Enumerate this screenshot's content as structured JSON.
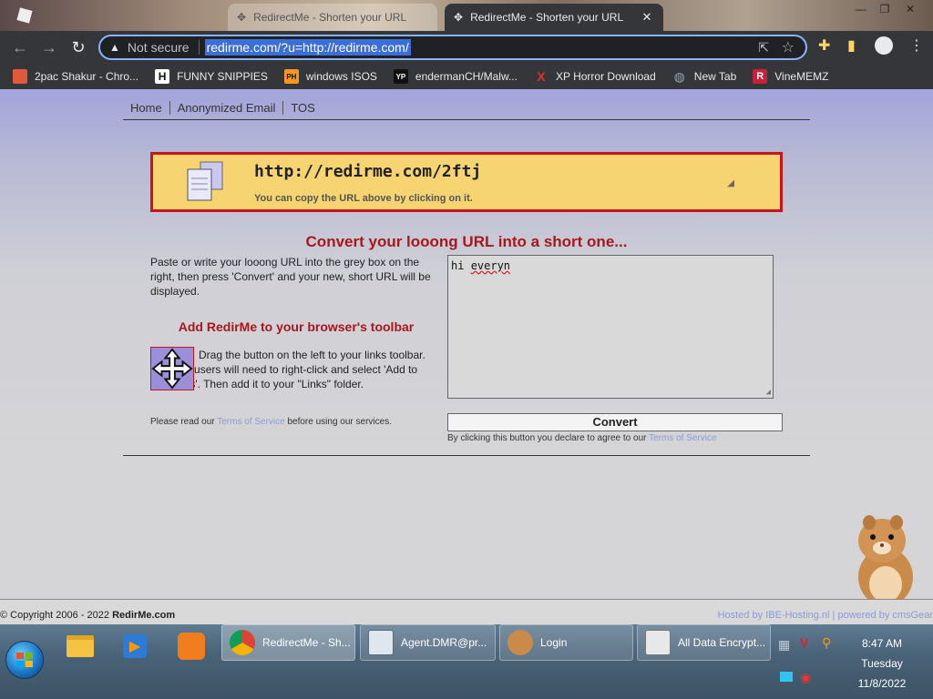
{
  "browser": {
    "tabs": [
      {
        "title": "RedirectMe - Shorten your URL",
        "active": false
      },
      {
        "title": "RedirectMe - Shorten your URL",
        "active": true
      }
    ],
    "address": {
      "security_label": "Not secure",
      "url": "redirme.com/?u=http://redirme.com/"
    },
    "bookmarks": [
      {
        "label": "2pac Shakur - Chro...",
        "icon": "suitcase-icon",
        "color": "#e05a3a"
      },
      {
        "label": "FUNNY SNIPPIES",
        "icon": "h-icon",
        "glyph": "H",
        "color": "#ffffff"
      },
      {
        "label": "windows ISOS",
        "icon": "ph-icon",
        "glyph": "PH",
        "color": "#f7971d"
      },
      {
        "label": "endermanCH/Malw...",
        "icon": "yp-icon",
        "glyph": "YP",
        "color": "#111111"
      },
      {
        "label": "XP Horror Download",
        "icon": "x-icon",
        "glyph": "X",
        "color": "#e03030"
      },
      {
        "label": "New Tab",
        "icon": "globe-icon",
        "glyph": "◍",
        "color": "#9aa0a6"
      },
      {
        "label": "VineMEMZ",
        "icon": "r-icon",
        "glyph": "R",
        "color": "#c8203a"
      }
    ]
  },
  "site": {
    "nav": [
      "Home",
      "Anonymized Email",
      "TOS"
    ],
    "short_url": "http://redirme.com/2ftj",
    "copy_hint": "You can copy the URL above by clicking on it.",
    "heading": "Convert your looong URL into a short one...",
    "instructions": "Paste or write your looong URL into the grey box on the right, then press 'Convert' and your new, short URL will be displayed.",
    "toolbar_heading": "Add RedirMe to your browser's toolbar",
    "drag_text": "Drag the button on the left to your links toolbar. Explorer users will need to right-click and select 'Add to Favorites'. Then add it to your \"Links\" folder.",
    "read_terms_prefix": "Please read our",
    "terms_link": "Terms of Service",
    "read_terms_suffix": "before using our services.",
    "input_prefix": "hi ",
    "input_misspelled": "everyn",
    "convert_label": "Convert",
    "agree_prefix": "By clicking this button you declare to agree to our",
    "footer_copyright": "© Copyright 2006 - 2022",
    "footer_brand": "RedirMe.com",
    "footer_hosted": "Hosted by IBE-Hosting.nl | powered by cmsGear"
  },
  "taskbar": {
    "tasks": [
      {
        "label": "RedirectMe - Sh...",
        "icon": "chrome-icon",
        "active": true
      },
      {
        "label": "Agent.DMR@pr...",
        "icon": "window-icon",
        "active": false
      },
      {
        "label": "Login",
        "icon": "hamster-icon",
        "active": false
      },
      {
        "label": "All Data Encrypt...",
        "icon": "document-icon",
        "active": false
      }
    ],
    "clock": {
      "time": "8:47 AM",
      "day": "Tuesday",
      "date": "11/8/2022"
    }
  },
  "colors": {
    "accent_red": "#c8141c",
    "heading_red": "#a8171c",
    "short_box_bg": "#f6d472",
    "page_bg_top": "#a3a4da",
    "link": "#8c9ad6"
  }
}
